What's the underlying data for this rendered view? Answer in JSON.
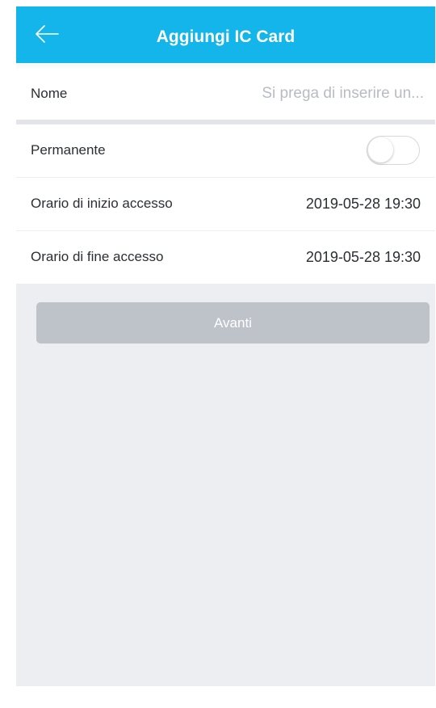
{
  "header": {
    "title": "Aggiungi IC Card",
    "background": "#13b5ea",
    "back_icon": "arrow-left-icon"
  },
  "form": {
    "name_label": "Nome",
    "name_placeholder": "Si prega di inserire un...",
    "name_value": ""
  },
  "settings": {
    "permanent_label": "Permanente",
    "permanent_enabled": false,
    "start_label": "Orario di inizio accesso",
    "start_value": "2019-05-28 19:30",
    "end_label": "Orario di fine accesso",
    "end_value": "2019-05-28 19:30"
  },
  "actions": {
    "next_label": "Avanti",
    "next_enabled": false,
    "next_color": "#bec3ca"
  }
}
